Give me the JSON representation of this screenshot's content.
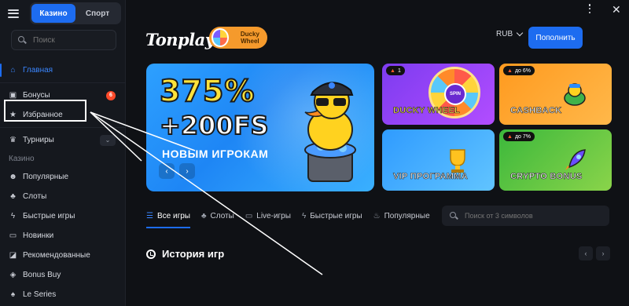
{
  "sidebar": {
    "segment": {
      "casino": "Казино",
      "sport": "Спорт"
    },
    "search_placeholder": "Поиск",
    "items": [
      {
        "label": "Главная",
        "icon": "home-icon"
      },
      {
        "label": "Бонусы",
        "icon": "gift-icon",
        "badge": "6"
      },
      {
        "label": "Избранное",
        "icon": "star-icon"
      },
      {
        "label": "Турниры",
        "icon": "trophy-icon"
      }
    ],
    "section": "Казино",
    "casino_items": [
      {
        "label": "Популярные",
        "icon": "users-icon"
      },
      {
        "label": "Слоты",
        "icon": "cherry-icon"
      },
      {
        "label": "Быстрые игры",
        "icon": "lightning-icon"
      },
      {
        "label": "Новинки",
        "icon": "new-icon"
      },
      {
        "label": "Рекомендованные",
        "icon": "thumb-icon"
      },
      {
        "label": "Bonus Buy",
        "icon": "bag-icon"
      },
      {
        "label": "Le Series",
        "icon": "cherries-icon"
      }
    ]
  },
  "header": {
    "logo": "Tonplay",
    "ducky_logo": "Ducky Wheel",
    "currency": "RUB",
    "deposit": "Пополнить"
  },
  "hero": {
    "line1": "375%",
    "line2": "+200FS",
    "line3": "НОВЫМ ИГРОКАМ"
  },
  "tiles": [
    {
      "label": "DUCKY WHEEL",
      "tag": "1",
      "spin": "SPIN"
    },
    {
      "label": "CASHBACK",
      "tag": "до 6%"
    },
    {
      "label": "VIP ПРОГРАММА",
      "tag": ""
    },
    {
      "label": "CRYPTO BONUS",
      "tag": "до 7%"
    }
  ],
  "tabs": [
    {
      "label": "Все игры",
      "icon": "grid-icon"
    },
    {
      "label": "Слоты",
      "icon": "cherry-icon"
    },
    {
      "label": "Live-игры",
      "icon": "tv-icon"
    },
    {
      "label": "Быстрые игры",
      "icon": "lightning-icon"
    },
    {
      "label": "Популярные",
      "icon": "fire-icon"
    }
  ],
  "games_search_placeholder": "Поиск от 3 символов",
  "history_title": "История игр",
  "colors": {
    "accent": "#1d6cf0",
    "bg": "#0f1115",
    "sidebar": "#15181e"
  }
}
